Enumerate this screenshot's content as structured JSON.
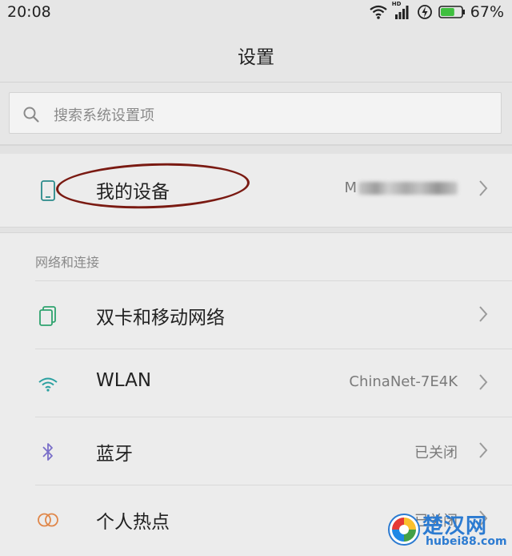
{
  "status_bar": {
    "time": "20:08",
    "icons": [
      "wifi-icon",
      "hd-signal-icon",
      "charging-icon",
      "battery-icon"
    ],
    "hd_label": "HD",
    "battery_percent": "67%",
    "battery_level": 0.67,
    "battery_color": "#3fbf3f"
  },
  "header": {
    "title": "设置"
  },
  "search": {
    "placeholder": "搜索系统设置项"
  },
  "my_device": {
    "label": "我的设备",
    "value_visible": "M",
    "icon": "phone-icon",
    "icon_color": "#2a8a8a"
  },
  "network_section": {
    "header": "网络和连接",
    "items": [
      {
        "label": "双卡和移动网络",
        "value": "",
        "icon": "sim-card-icon",
        "icon_color": "#2ea36e"
      },
      {
        "label": "WLAN",
        "value": "ChinaNet-7E4K",
        "icon": "wifi-icon",
        "icon_color": "#2aa0a0"
      },
      {
        "label": "蓝牙",
        "value": "已关闭",
        "icon": "bluetooth-icon",
        "icon_color": "#7a6fc9"
      },
      {
        "label": "个人热点",
        "value": "已关闭",
        "icon": "hotspot-icon",
        "icon_color": "#e0874a"
      }
    ]
  },
  "annotation": {
    "ellipse_color": "#7a1a12"
  },
  "watermark": {
    "text": "楚汉网",
    "url": "hubei88.com",
    "color": "#2c7bd1"
  }
}
